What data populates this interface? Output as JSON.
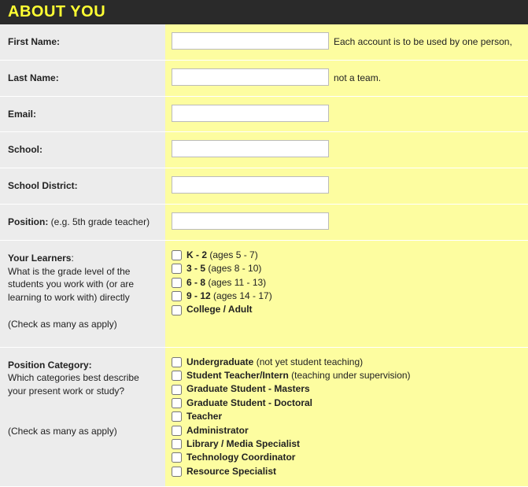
{
  "header": "ABOUT YOU",
  "rows": {
    "first_name": {
      "label": "First Name:",
      "hint": "Each account is to be used by one person,"
    },
    "last_name": {
      "label": "Last Name:",
      "hint": "not a team."
    },
    "email": {
      "label": "Email:"
    },
    "school": {
      "label": "School:"
    },
    "district": {
      "label": "School District:"
    },
    "position": {
      "label_bold": "Position:",
      "label_light": " (e.g. 5th grade teacher)"
    },
    "learners": {
      "label_bold": "Your Learners",
      "sub": "What is the grade level of the students you work with (or are learning to work with) directly",
      "note": "(Check as many as apply)",
      "options": [
        {
          "bold": "K - 2",
          "light": " (ages 5 - 7)"
        },
        {
          "bold": "3 - 5",
          "light": " (ages 8 - 10)"
        },
        {
          "bold": "6 - 8",
          "light": " (ages 11 - 13)"
        },
        {
          "bold": "9 - 12",
          "light": " (ages 14 - 17)"
        },
        {
          "bold": "College / Adult",
          "light": ""
        }
      ]
    },
    "category": {
      "label_bold": "Position Category:",
      "sub": "Which categories best describe your present work or study?",
      "note": "(Check as many as apply)",
      "options": [
        {
          "bold": "Undergraduate",
          "light": " (not yet student teaching)"
        },
        {
          "bold": "Student Teacher/Intern",
          "light": " (teaching under supervision)"
        },
        {
          "bold": "Graduate Student - Masters",
          "light": ""
        },
        {
          "bold": "Graduate Student - Doctoral",
          "light": ""
        },
        {
          "bold": "Teacher",
          "light": ""
        },
        {
          "bold": "Administrator",
          "light": ""
        },
        {
          "bold": "Library / Media Specialist",
          "light": ""
        },
        {
          "bold": "Technology Coordinator",
          "light": ""
        },
        {
          "bold": "Resource Specialist",
          "light": ""
        }
      ]
    }
  }
}
